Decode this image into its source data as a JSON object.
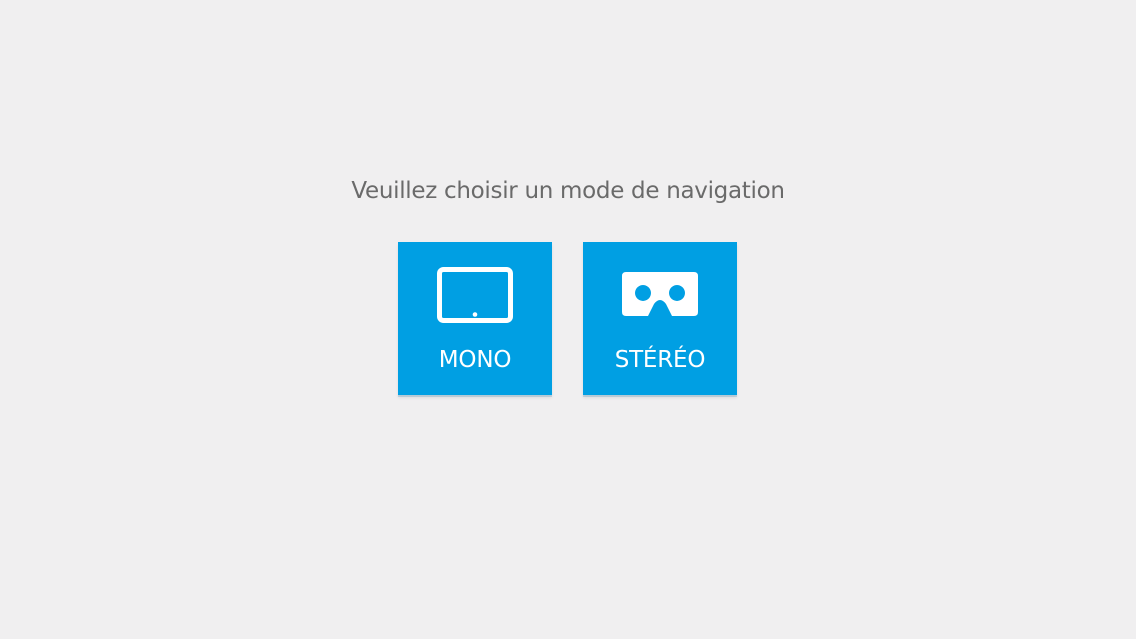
{
  "prompt": {
    "text": "Veuillez choisir un mode de navigation"
  },
  "modes": [
    {
      "label": "MONO",
      "icon": "tablet-icon"
    },
    {
      "label": "STÉRÉO",
      "icon": "vr-headset-icon"
    }
  ],
  "colors": {
    "background": "#f0eff0",
    "tile": "#009fe3",
    "prompt_text": "#6a6a6a",
    "tile_text": "#ffffff"
  }
}
